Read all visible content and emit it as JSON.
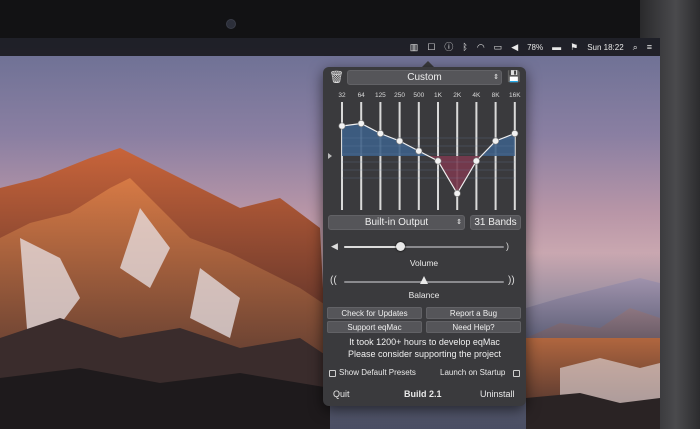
{
  "menubar": {
    "battery": "78%",
    "clock": "Sun 18:22"
  },
  "eq": {
    "preset": "Custom",
    "frequencies": [
      "32",
      "64",
      "125",
      "250",
      "500",
      "1K",
      "2K",
      "4K",
      "8K",
      "16K"
    ],
    "band_gains_db": [
      6,
      6.5,
      4.5,
      3,
      1,
      -1,
      -7.5,
      -1,
      3,
      4.5
    ],
    "output_device": "Built-in Output",
    "bands_mode": "31 Bands"
  },
  "volume": {
    "label": "Volume",
    "level": 0.35
  },
  "balance": {
    "label": "Balance",
    "level": 0.5
  },
  "buttons": {
    "check_updates": "Check for Updates",
    "report_bug": "Report a Bug",
    "support": "Support eqMac",
    "help": "Need Help?"
  },
  "message": {
    "line1": "It took 1200+ hours to develop eqMac",
    "line2": "Please consider supporting the project"
  },
  "options": {
    "show_presets": "Show Default Presets",
    "launch_startup": "Launch on Startup"
  },
  "footer": {
    "quit": "Quit",
    "build": "Build 2.1",
    "uninstall": "Uninstall"
  },
  "colors": {
    "boost": "#3d5f86",
    "cut": "#7a3a4e",
    "panel": "#3a3a3d"
  }
}
